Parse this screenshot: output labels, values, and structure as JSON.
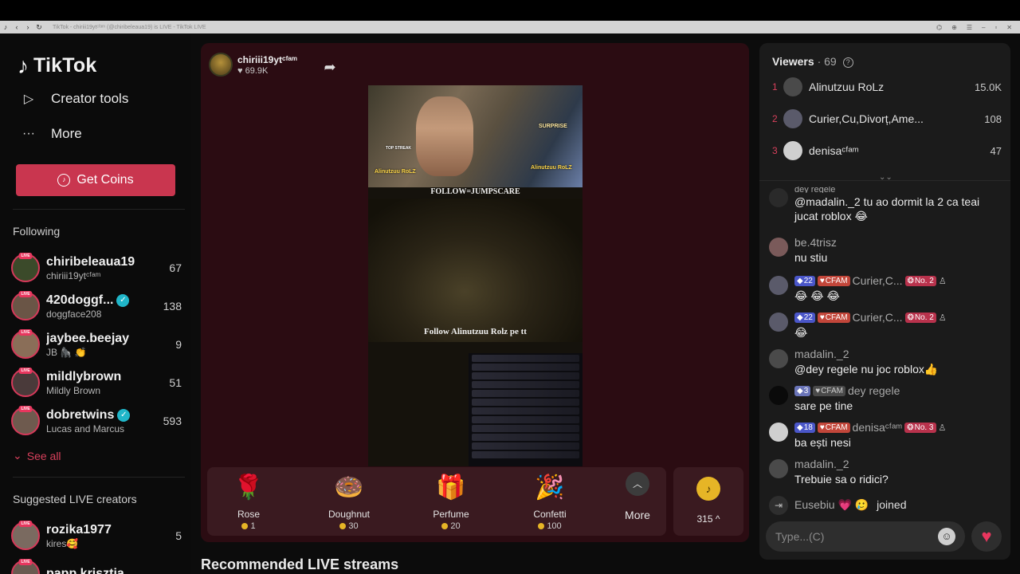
{
  "browser": {
    "tab_title": "TikTok - chiriii19ytᶜᶠᵃᵐ (@chiribeleaua19) is LIVE - TikTok LIVE"
  },
  "sidebar": {
    "logo": "TikTok",
    "nav": [
      {
        "label": "Creator tools",
        "icon": "creator-tools-icon"
      },
      {
        "label": "More",
        "icon": "more-dots-icon"
      }
    ],
    "get_coins": "Get Coins",
    "following_title": "Following",
    "following": [
      {
        "username": "chiribeleaua19",
        "display": "chiriii19ytᶜᶠᵃᵐ",
        "viewers": "67",
        "verified": false,
        "avatar_color": "#3b4a2a"
      },
      {
        "username": "420doggf...",
        "display": "doggface208",
        "viewers": "138",
        "verified": true,
        "avatar_color": "#6a5546"
      },
      {
        "username": "jaybee.beejay",
        "display": "JB 🦍 👏",
        "viewers": "9",
        "verified": false,
        "avatar_color": "#8a6e58"
      },
      {
        "username": "mildlybrown",
        "display": "Mildly Brown",
        "viewers": "51",
        "verified": false,
        "avatar_color": "#4a3a3a"
      },
      {
        "username": "dobretwins",
        "display": "Lucas and Marcus",
        "viewers": "593",
        "verified": true,
        "avatar_color": "#6e5a4e"
      }
    ],
    "see_all": "See all",
    "suggested_title": "Suggested LIVE creators",
    "suggested": [
      {
        "username": "rozika1977",
        "display": "kires🥰",
        "viewers": "5",
        "avatar_color": "#7a6a60"
      },
      {
        "username": "papp.krisztia",
        "display": "",
        "viewers": "",
        "avatar_color": "#6a5a50"
      }
    ]
  },
  "player": {
    "host_name": "chiriii19ytᶜᶠᵃᵐ",
    "host_likes": "69.9K",
    "stream_text": {
      "follow_top": "FOLLOW=JUMPSCARE",
      "follow_bottom": "Follow Alinutzuu Rolz pe tt",
      "surprise": "SURPRISE",
      "top_streak": "TOP STREAK",
      "cam_name_left": "Alinutzuu RoLZ",
      "cam_name_right": "Alinutzuu RoLZ"
    },
    "gifts": [
      {
        "name": "Rose",
        "price": "1",
        "icon": "🌹"
      },
      {
        "name": "Doughnut",
        "price": "30",
        "icon": "🍩"
      },
      {
        "name": "Perfume",
        "price": "20",
        "icon": "🎁"
      },
      {
        "name": "Confetti",
        "price": "100",
        "icon": "🎉"
      }
    ],
    "more_label": "More",
    "coin_balance": "315"
  },
  "recommended_title": "Recommended LIVE streams",
  "chat": {
    "viewers_label": "Viewers",
    "viewers_count": "· 69",
    "top_viewers": [
      {
        "rank": "1",
        "name": "Alinutzuu RoLz",
        "score": "15.0K",
        "avatar_color": "#4a4a4a"
      },
      {
        "rank": "2",
        "name": "Curier,Cu,Divorț,Ame...",
        "score": "108",
        "avatar_color": "#5a5a6a"
      },
      {
        "rank": "3",
        "name": "denisaᶜᶠᵃᵐ",
        "score": "47",
        "avatar_color": "#cfcfcf"
      }
    ],
    "messages": [
      {
        "user": "dey regele",
        "text": "@madalin._2 tu ao dormit la 2 ca teai jucat roblox 😂",
        "avatar_color": "#2a2a2a",
        "badges": []
      },
      {
        "user": "be.4trisz",
        "text": "nu stiu",
        "avatar_color": "#7a5a5a",
        "badges": []
      },
      {
        "user": "Curier,C...",
        "text": "😂 😂 😂",
        "avatar_color": "#5a5a6a",
        "badges": [
          "22",
          "CFAM",
          "No. 2"
        ]
      },
      {
        "user": "Curier,C...",
        "text": "😂",
        "avatar_color": "#5a5a6a",
        "badges": [
          "22",
          "CFAM",
          "No. 2"
        ]
      },
      {
        "user": "madalin._2",
        "text": "@dey regele nu joc roblox👍",
        "avatar_color": "#4a4a4a",
        "badges": []
      },
      {
        "user": "dey regele",
        "text": "sare pe tine",
        "avatar_color": "#0a0a0a",
        "badges": [
          "3",
          "CFAM"
        ]
      },
      {
        "user": "denisaᶜᶠᵃᵐ",
        "text": "ba ești nesi",
        "avatar_color": "#cfcfcf",
        "badges": [
          "18",
          "CFAM",
          "No. 3"
        ]
      },
      {
        "user": "madalin._2",
        "text": "Trebuie sa o ridici?",
        "avatar_color": "#4a4a4a",
        "badges": []
      }
    ],
    "join_user": "Eusebiu 💗 🥲",
    "join_text": "joined",
    "input_placeholder": "Type...(C)"
  }
}
